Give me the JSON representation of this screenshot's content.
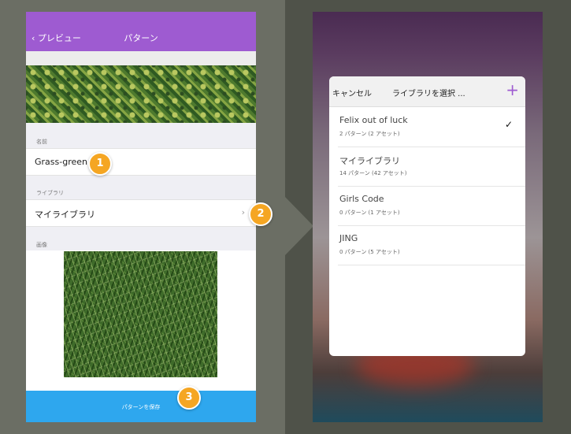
{
  "left": {
    "nav": {
      "back_label": "‹ プレビュー",
      "title": "パターン"
    },
    "name_section": {
      "label": "名前",
      "value": "Grass-green"
    },
    "library_section": {
      "label": "ライブラリ",
      "value": "マイライブラリ"
    },
    "image_section": {
      "label": "画像"
    },
    "save_button": {
      "label": "パターンを保存"
    }
  },
  "badges": [
    "1",
    "2",
    "3"
  ],
  "right": {
    "header": {
      "cancel_label": "キャンセル",
      "title": "ライブラリを選択 ...",
      "add_icon": "plus-icon"
    },
    "libraries": [
      {
        "name": "Felix out of luck",
        "sub": "2 パターン (2 アセット)",
        "selected": true
      },
      {
        "name": "マイライブラリ",
        "sub": "14 パターン (42 アセット)",
        "selected": false
      },
      {
        "name": "Girls Code",
        "sub": "0 パターン (1 アセット)",
        "selected": false
      },
      {
        "name": "JING",
        "sub": "0 パターン (5 アセット)",
        "selected": false
      }
    ],
    "check_glyph": "✓"
  },
  "colors": {
    "nav": "#9e5bd1",
    "save": "#2ea7ee",
    "badge": "#f5a623"
  }
}
